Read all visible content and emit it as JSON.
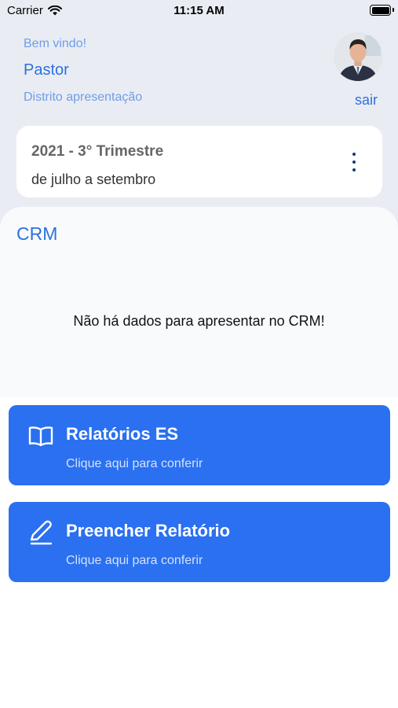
{
  "status_bar": {
    "carrier": "Carrier",
    "time": "11:15 AM"
  },
  "header": {
    "welcome": "Bem vindo!",
    "role": "Pastor",
    "district": "Distrito apresentação",
    "logout_label": "sair"
  },
  "period": {
    "title": "2021 - 3° Trimestre",
    "range": "de julho a setembro"
  },
  "crm": {
    "title": "CRM",
    "empty_message": "Não há dados para apresentar no CRM!"
  },
  "actions": [
    {
      "title": "Relatórios ES",
      "subtitle": "Clique aqui para conferir",
      "icon": "book-icon"
    },
    {
      "title": "Preencher Relatório",
      "subtitle": "Clique aqui para conferir",
      "icon": "pencil-icon"
    }
  ],
  "colors": {
    "primary": "#2a70f0",
    "accent_text": "#2f6fe0",
    "header_bg": "#e9edf3"
  }
}
